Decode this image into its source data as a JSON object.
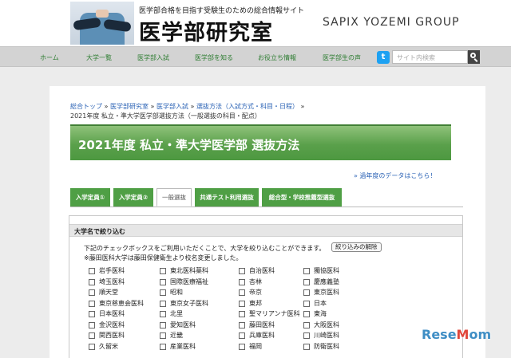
{
  "header": {
    "tagline": "医学部合格を目指す受験生のための総合情報サイト",
    "site_title": "医学部研究室",
    "group": "SAPIX YOZEMI GROUP"
  },
  "nav": {
    "items": [
      "ホーム",
      "大学一覧",
      "医学部入試",
      "医学部を知る",
      "お役立ち情報",
      "医学部生の声"
    ],
    "twitter_icon_char": "t",
    "search_placeholder": "サイト内検索"
  },
  "breadcrumb": {
    "links": [
      "総合トップ",
      "医学部研究室",
      "医学部入試",
      "選抜方法（入試方式・科目・日程）"
    ],
    "separator": "»",
    "current": "2021年度 私立・準大学医学部選抜方法（一般選抜の科目・配点）"
  },
  "page_title": "2021年度 私立・準大学医学部 選抜方法",
  "past_data_link": "» 過年度のデータはこちら！",
  "tabs": [
    "入学定員①",
    "入学定員②",
    "一般選抜",
    "共通テスト利用選抜",
    "総合型・学校推薦型選抜"
  ],
  "active_tab": 2,
  "filter": {
    "heading": "大学名で絞り込む",
    "note1": "下記のチェックボックスをご利用いただくことで、大学を絞り込むことができます。",
    "reset_label": "絞り込みの解除",
    "note2": "※藤田医科大学は藤田保健衛生より校名変更しました。",
    "universities": [
      [
        "岩手医科",
        "東北医科薬科",
        "自治医科",
        "獨協医科"
      ],
      [
        "埼玉医科",
        "国際医療福祉",
        "杏林",
        "慶應義塾"
      ],
      [
        "順天堂",
        "昭和",
        "帝京",
        "東京医科"
      ],
      [
        "東京慈恵会医科",
        "東京女子医科",
        "東邦",
        "日本"
      ],
      [
        "日本医科",
        "北里",
        "聖マリアンナ医科",
        "東海"
      ],
      [
        "金沢医科",
        "愛知医科",
        "藤田医科",
        "大阪医科"
      ],
      [
        "関西医科",
        "近畿",
        "兵庫医科",
        "川崎医科"
      ],
      [
        "久留米",
        "産業医科",
        "福岡",
        "防衛医科"
      ]
    ]
  },
  "watermark": {
    "part1": "Rese",
    "accent": "M",
    "part2": "om"
  },
  "colors": {
    "accent_green": "#4f9f45",
    "link_blue": "#2a62b5",
    "nav_text": "#2e7d32"
  }
}
